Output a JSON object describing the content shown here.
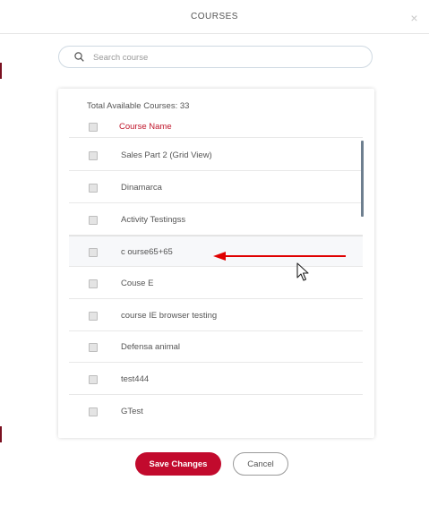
{
  "modal": {
    "title": "COURSES",
    "close_icon": "close-icon"
  },
  "search": {
    "placeholder": "Search course",
    "value": ""
  },
  "list": {
    "total_label": "Total Available Courses: 33",
    "header_label": "Course Name",
    "items": [
      {
        "label": "Sales Part 2 (Grid View)"
      },
      {
        "label": "Dinamarca"
      },
      {
        "label": "Activity Testingss"
      },
      {
        "label": "c ourse65+65"
      },
      {
        "label": "Couse E"
      },
      {
        "label": "course IE browser testing"
      },
      {
        "label": "Defensa animal"
      },
      {
        "label": "test444"
      },
      {
        "label": "GTest"
      }
    ]
  },
  "buttons": {
    "save_label": "Save Changes",
    "cancel_label": "Cancel"
  },
  "colors": {
    "accent": "#c20a2d",
    "header_label": "#c0172c",
    "annotation_arrow": "#e00000"
  }
}
